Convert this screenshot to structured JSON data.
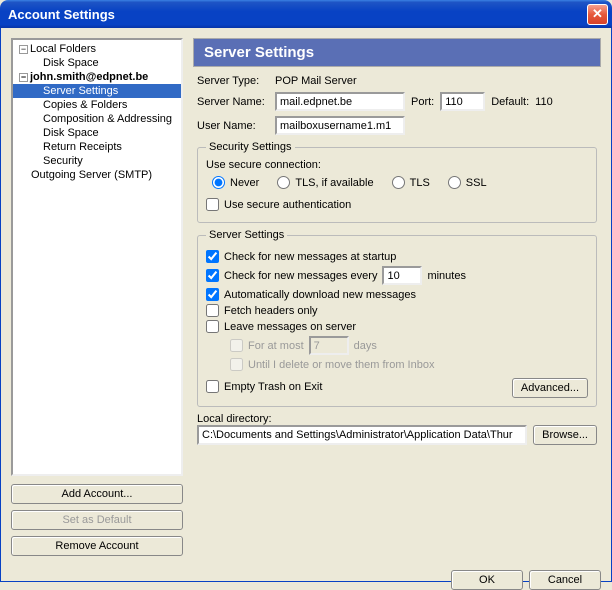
{
  "window": {
    "title": "Account Settings"
  },
  "tree": {
    "local_folders": "Local Folders",
    "disk_space": "Disk Space",
    "account": "john.smith@edpnet.be",
    "items": {
      "server_settings": "Server Settings",
      "copies_folders": "Copies & Folders",
      "composition": "Composition & Addressing",
      "disk_space2": "Disk Space",
      "return_receipts": "Return Receipts",
      "security": "Security"
    },
    "outgoing": "Outgoing Server (SMTP)"
  },
  "left_buttons": {
    "add": "Add Account...",
    "setdefault": "Set as Default",
    "remove": "Remove Account"
  },
  "panel": {
    "title": "Server Settings",
    "server_type_lbl": "Server Type:",
    "server_type_val": "POP Mail Server",
    "server_name_lbl": "Server Name:",
    "server_name_val": "mail.edpnet.be",
    "port_lbl": "Port:",
    "port_val": "110",
    "default_lbl": "Default:",
    "default_val": "110",
    "user_name_lbl": "User Name:",
    "user_name_val": "mailboxusername1.m1"
  },
  "security": {
    "legend": "Security Settings",
    "use_secure_lbl": "Use secure connection:",
    "opt_never": "Never",
    "opt_tls_avail": "TLS, if available",
    "opt_tls": "TLS",
    "opt_ssl": "SSL",
    "use_auth": "Use secure authentication"
  },
  "server": {
    "legend": "Server Settings",
    "check_startup": "Check for new messages at startup",
    "check_every_pre": "Check for new messages every",
    "check_every_val": "10",
    "check_every_post": "minutes",
    "auto_download": "Automatically download new messages",
    "fetch_headers": "Fetch headers only",
    "leave_msgs": "Leave messages on server",
    "for_at_most_pre": "For at most",
    "for_at_most_val": "7",
    "for_at_most_post": "days",
    "until_delete": "Until I delete or move them from Inbox",
    "empty_trash": "Empty Trash on Exit",
    "advanced": "Advanced..."
  },
  "local": {
    "label": "Local directory:",
    "path": "C:\\Documents and Settings\\Administrator\\Application Data\\Thur",
    "browse": "Browse..."
  },
  "dialog": {
    "ok": "OK",
    "cancel": "Cancel"
  }
}
